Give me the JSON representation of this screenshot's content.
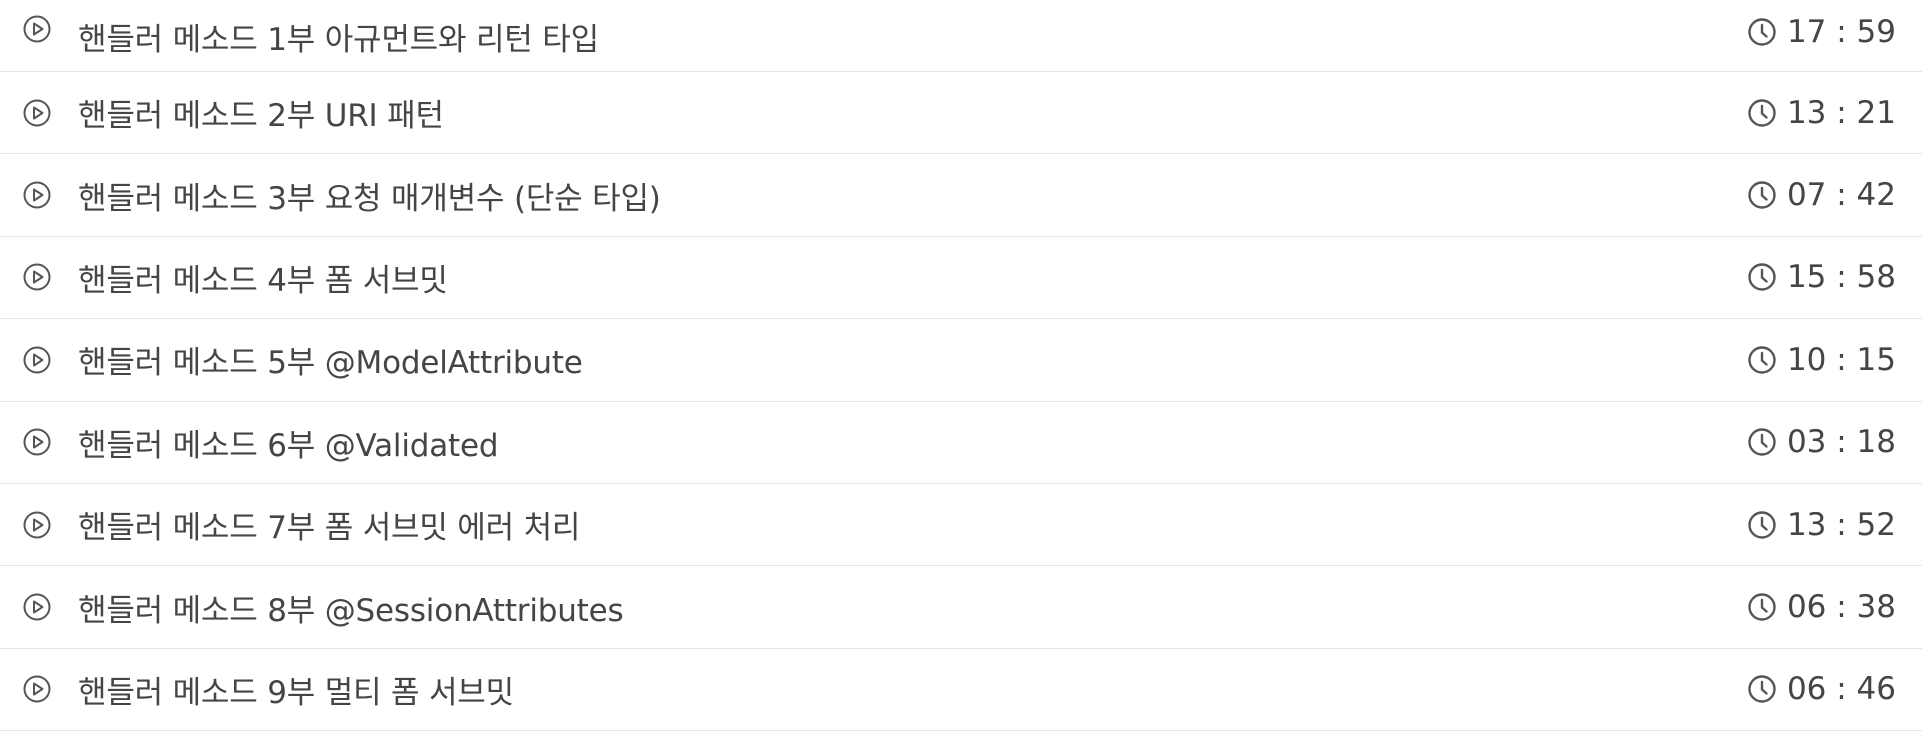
{
  "lectures": [
    {
      "title": "핸들러 메소드 1부 아규먼트와 리턴 타입",
      "duration": "17 : 59"
    },
    {
      "title": "핸들러 메소드 2부 URI 패턴",
      "duration": "13 : 21"
    },
    {
      "title": "핸들러 메소드 3부 요청 매개변수 (단순 타입)",
      "duration": "07 : 42"
    },
    {
      "title": "핸들러 메소드 4부 폼 서브밋",
      "duration": "15 : 58"
    },
    {
      "title": "핸들러 메소드 5부 @ModelAttribute",
      "duration": "10 : 15"
    },
    {
      "title": "핸들러 메소드 6부 @Validated",
      "duration": "03 : 18"
    },
    {
      "title": "핸들러 메소드 7부 폼 서브밋 에러 처리",
      "duration": "13 : 52"
    },
    {
      "title": "핸들러 메소드 8부 @SessionAttributes",
      "duration": "06 : 38"
    },
    {
      "title": "핸들러 메소드 9부 멀티 폼 서브밋",
      "duration": "06 : 46"
    }
  ],
  "icons": {
    "play": "play-circle-icon",
    "clock": "clock-icon"
  },
  "colors": {
    "text": "#454545",
    "divider": "#e6e6e6",
    "background": "#ffffff"
  }
}
